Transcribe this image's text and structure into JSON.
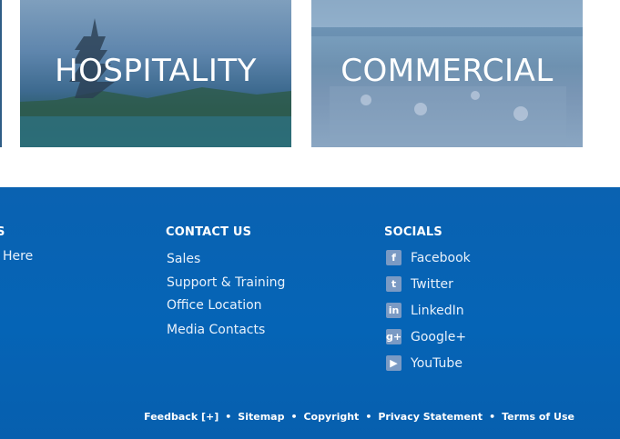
{
  "tiles": [
    {
      "title": "HOSPITALITY"
    },
    {
      "title": "COMMERCIAL"
    }
  ],
  "footer": {
    "left_column": {
      "heading": "S",
      "link": "Here"
    },
    "contact": {
      "heading": "CONTACT US",
      "links": [
        "Sales",
        "Support & Training",
        "Office Location",
        "Media Contacts"
      ]
    },
    "socials": {
      "heading": "SOCIALS",
      "items": [
        {
          "label": "Facebook",
          "icon": "facebook-icon",
          "glyph": "f"
        },
        {
          "label": "Twitter",
          "icon": "twitter-icon",
          "glyph": "t"
        },
        {
          "label": "LinkedIn",
          "icon": "linkedin-icon",
          "glyph": "in"
        },
        {
          "label": "Google+",
          "icon": "google-plus-icon",
          "glyph": "g+"
        },
        {
          "label": "YouTube",
          "icon": "youtube-icon",
          "glyph": "▶"
        }
      ]
    },
    "bottom_links": [
      "Feedback [+]",
      "Sitemap",
      "Copyright",
      "Privacy Statement",
      "Terms of Use"
    ],
    "separator": "•"
  },
  "colors": {
    "footer_bg": "#0564b6",
    "social_icon_bg": "#7a9ac4",
    "tile_text": "#ffffff"
  }
}
